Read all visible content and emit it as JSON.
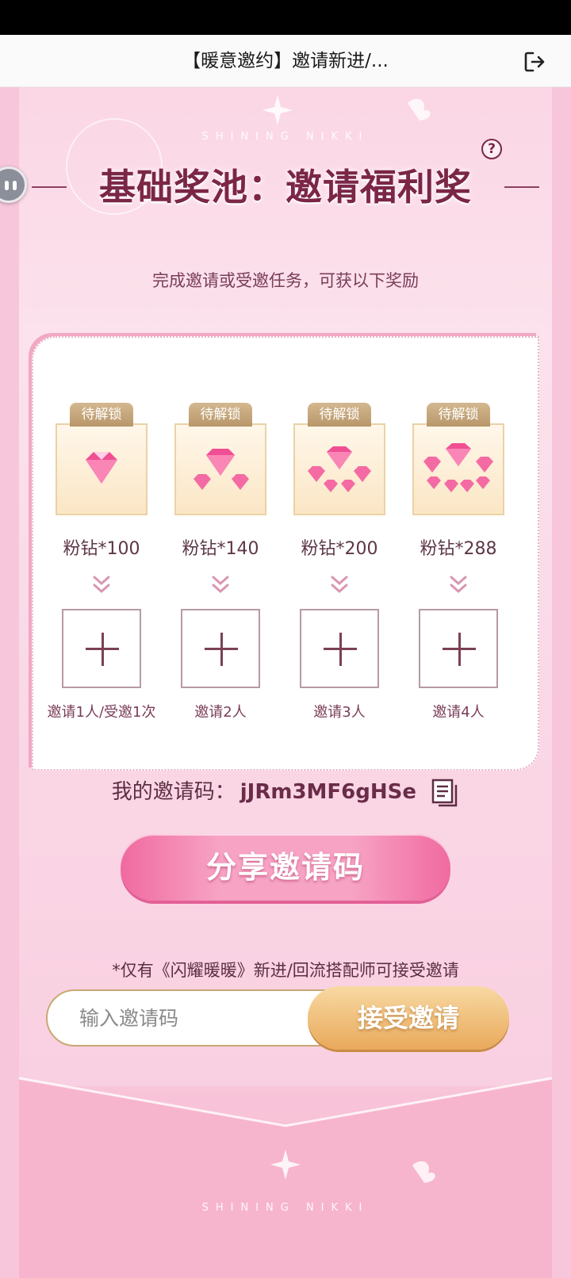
{
  "topbar": {
    "title": "【暖意邀约】邀请新进/..."
  },
  "brand": "SHINING NIKKI",
  "heading": "基础奖池：邀请福利奖",
  "subtitle": "完成邀请或受邀任务，可获以下奖励",
  "rewards": [
    {
      "tag": "待解锁",
      "label": "粉钻*100",
      "slot_label": "邀请1人/受邀1次"
    },
    {
      "tag": "待解锁",
      "label": "粉钻*140",
      "slot_label": "邀请2人"
    },
    {
      "tag": "待解锁",
      "label": "粉钻*200",
      "slot_label": "邀请3人"
    },
    {
      "tag": "待解锁",
      "label": "粉钻*288",
      "slot_label": "邀请4人"
    }
  ],
  "invite": {
    "label": "我的邀请码：",
    "code": "jJRm3MF6gHSe"
  },
  "share_label": "分享邀请码",
  "note": "*仅有《闪耀暖暖》新进/回流搭配师可接受邀请",
  "input": {
    "placeholder": "输入邀请码",
    "value": ""
  },
  "accept_label": "接受邀请",
  "brand_bottom": "SHINING NIKKI",
  "colors": {
    "accent": "#f06aa0",
    "gold": "#e9a95b",
    "text": "#7b2647"
  }
}
